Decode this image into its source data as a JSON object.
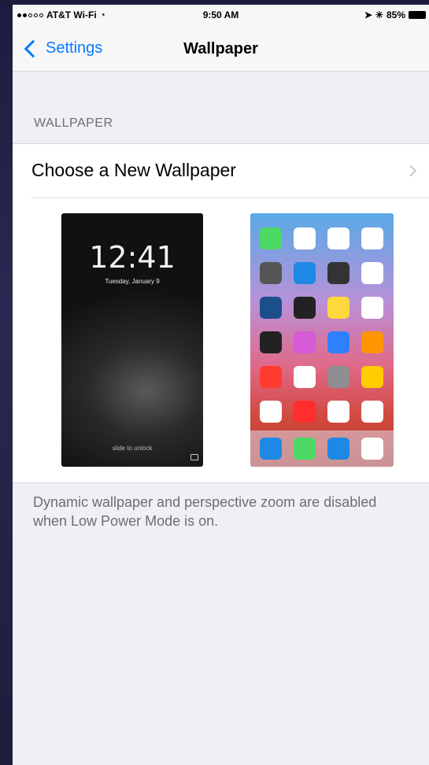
{
  "status_bar": {
    "carrier": "AT&T Wi-Fi",
    "time": "9:50 AM",
    "battery": "85%"
  },
  "nav": {
    "back_label": "Settings",
    "title": "Wallpaper"
  },
  "section": {
    "header": "WALLPAPER",
    "row_label": "Choose a New Wallpaper"
  },
  "lock_preview": {
    "time": "12:41",
    "date": "Tuesday, January 9",
    "slide_text": "slide to unlock"
  },
  "home_preview": {
    "app_colors": [
      "#4cd964",
      "#ffffff",
      "#ffffff",
      "#ffffff",
      "#555555",
      "#1e88e5",
      "#333333",
      "#ffffff",
      "#1b4f8c",
      "#222222",
      "#ffd83b",
      "#ffffff",
      "#222222",
      "#d65bd6",
      "#2f80ff",
      "#ff9500",
      "#ff3b30",
      "#ffffff",
      "#8e8e93",
      "#ffcc00",
      "#ffffff",
      "#ff2d2d",
      "#ffffff",
      "#ffffff"
    ],
    "dock_colors": [
      "#1e88e5",
      "#4cd964",
      "#1e88e5",
      "#ffffff"
    ]
  },
  "footer": {
    "note": "Dynamic wallpaper and perspective zoom are disabled when Low Power Mode is on."
  },
  "colors": {
    "accent": "#0a7aff",
    "background": "#efeff4"
  }
}
